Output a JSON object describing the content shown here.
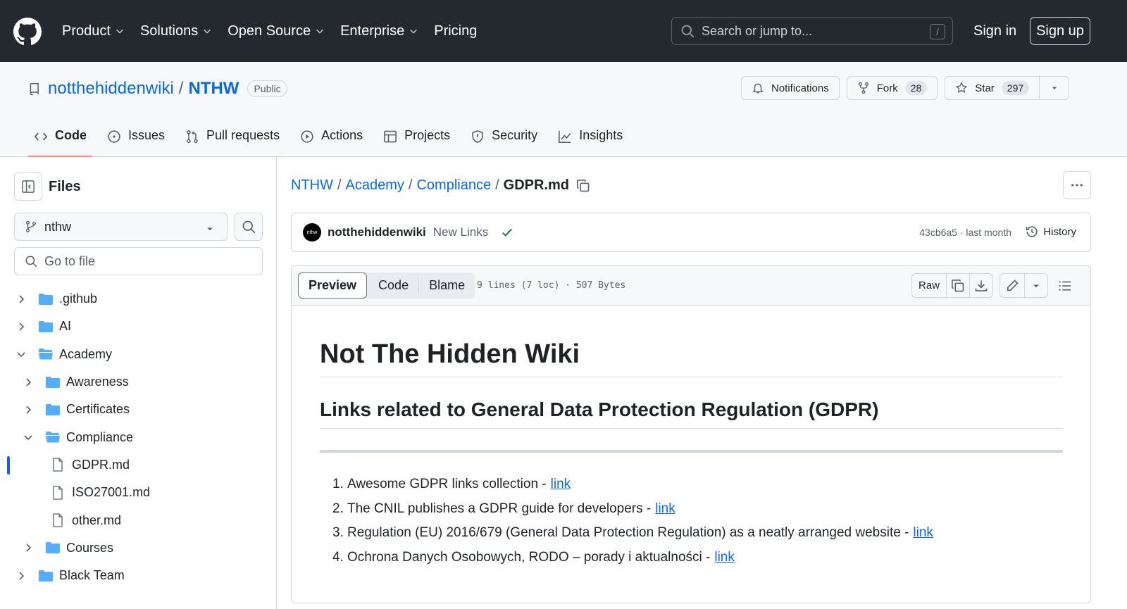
{
  "header": {
    "nav": [
      "Product",
      "Solutions",
      "Open Source",
      "Enterprise",
      "Pricing"
    ],
    "search_placeholder": "Search or jump to...",
    "search_key": "/",
    "sign_in": "Sign in",
    "sign_up": "Sign up"
  },
  "repo": {
    "owner": "notthehiddenwiki",
    "name": "NTHW",
    "visibility": "Public",
    "notifications_label": "Notifications",
    "fork_label": "Fork",
    "fork_count": "28",
    "star_label": "Star",
    "star_count": "297",
    "tabs": [
      {
        "label": "Code",
        "icon": "code-icon"
      },
      {
        "label": "Issues",
        "icon": "issue-icon"
      },
      {
        "label": "Pull requests",
        "icon": "pull-request-icon"
      },
      {
        "label": "Actions",
        "icon": "play-icon"
      },
      {
        "label": "Projects",
        "icon": "table-icon"
      },
      {
        "label": "Security",
        "icon": "shield-icon"
      },
      {
        "label": "Insights",
        "icon": "graph-icon"
      }
    ]
  },
  "sidebar": {
    "title": "Files",
    "branch": "nthw",
    "goto_placeholder": "Go to file",
    "tree": [
      {
        "label": ".github",
        "type": "folder",
        "depth": 0,
        "state": "collapsed"
      },
      {
        "label": "AI",
        "type": "folder",
        "depth": 0,
        "state": "collapsed"
      },
      {
        "label": "Academy",
        "type": "folder",
        "depth": 0,
        "state": "expanded"
      },
      {
        "label": "Awareness",
        "type": "folder",
        "depth": 1,
        "state": "collapsed"
      },
      {
        "label": "Certificates",
        "type": "folder",
        "depth": 1,
        "state": "collapsed"
      },
      {
        "label": "Compliance",
        "type": "folder",
        "depth": 1,
        "state": "expanded"
      },
      {
        "label": "GDPR.md",
        "type": "file",
        "depth": 2,
        "selected": true
      },
      {
        "label": "ISO27001.md",
        "type": "file",
        "depth": 2
      },
      {
        "label": "other.md",
        "type": "file",
        "depth": 2
      },
      {
        "label": "Courses",
        "type": "folder",
        "depth": 1,
        "state": "collapsed"
      },
      {
        "label": "Black Team",
        "type": "folder",
        "depth": 0,
        "state": "collapsed"
      }
    ]
  },
  "breadcrumb": {
    "parts": [
      "NTHW",
      "Academy",
      "Compliance"
    ],
    "current": "GDPR.md"
  },
  "commit": {
    "avatar_text": "nthw",
    "author": "notthehiddenwiki",
    "message": "New Links",
    "meta": "43cb6a5 · last month",
    "history_label": "History"
  },
  "file": {
    "tabs": [
      "Preview",
      "Code",
      "Blame"
    ],
    "info": "9 lines (7 loc) · 507 Bytes",
    "raw_label": "Raw"
  },
  "markdown": {
    "h1": "Not The Hidden Wiki",
    "h2": "Links related to General Data Protection Regulation (GDPR)",
    "items": [
      {
        "num": "1.",
        "text": "Awesome GDPR links collection -",
        "link": "link"
      },
      {
        "num": "2.",
        "text": "The CNIL publishes a GDPR guide for developers -",
        "link": "link"
      },
      {
        "num": "3.",
        "text": "Regulation (EU) 2016/679 (General Data Protection Regulation) as a neatly arranged website -",
        "link": "link"
      },
      {
        "num": "4.",
        "text": "Ochrona Danych Osobowych, RODO – porady i aktualności -",
        "link": "link"
      }
    ]
  },
  "colors": {
    "header_bg": "#24292f",
    "link": "#0969da",
    "tab_underline": "#fd8c73",
    "success": "#1a7f37",
    "folder": "#54aeff"
  }
}
